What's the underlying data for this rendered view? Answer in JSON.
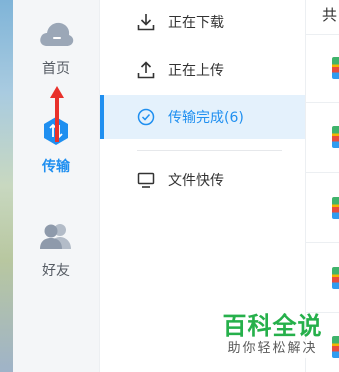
{
  "nav": {
    "items": [
      {
        "label": "首页",
        "icon": "cloud-icon",
        "active": false
      },
      {
        "label": "传输",
        "icon": "transfer-icon",
        "active": true
      },
      {
        "label": "好友",
        "icon": "friends-icon",
        "active": false
      }
    ]
  },
  "transfer_menu": {
    "items": [
      {
        "label": "正在下载",
        "icon": "download-icon",
        "selected": false
      },
      {
        "label": "正在上传",
        "icon": "upload-icon",
        "selected": false
      },
      {
        "label": "传输完成(6)",
        "icon": "check-circle-icon",
        "selected": true
      },
      {
        "label": "文件快传",
        "icon": "monitor-icon",
        "selected": false
      }
    ]
  },
  "right_panel": {
    "header": "共"
  },
  "watermark": {
    "main": "百科全说",
    "sub": "助你轻松解决"
  },
  "colors": {
    "accent": "#1f8ff0",
    "selected_bg": "#e4f1fc",
    "nav_bg": "#f4f6f8",
    "annotation_arrow": "#e8312b",
    "watermark_green": "#26b04b"
  }
}
